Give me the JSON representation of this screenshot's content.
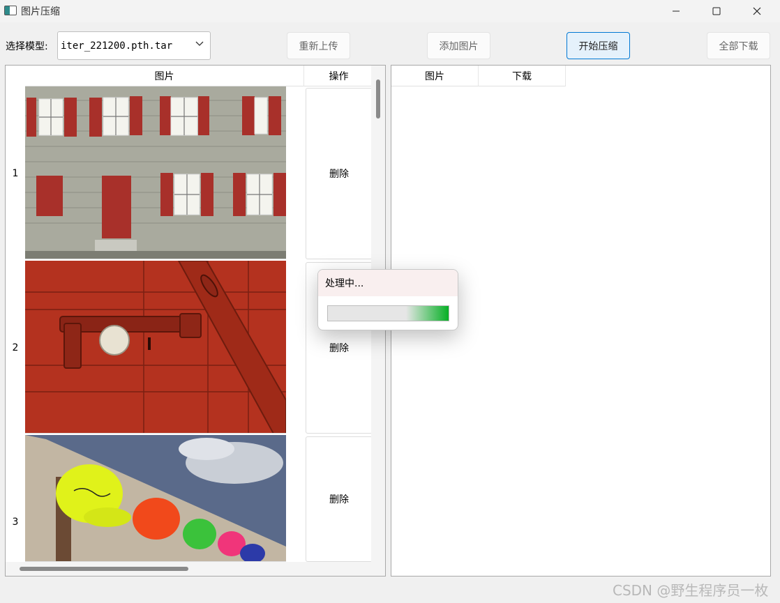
{
  "window": {
    "title": "图片压缩",
    "minimize_icon": "minimize-icon",
    "maximize_icon": "maximize-icon",
    "close_icon": "close-icon"
  },
  "toolbar": {
    "model_label": "选择模型:",
    "model_value": "iter_221200.pth.tar",
    "reupload_label": "重新上传",
    "add_image_label": "添加图片",
    "start_compress_label": "开始压缩",
    "download_all_label": "全部下载"
  },
  "left_table": {
    "columns": [
      "图片",
      "操作"
    ],
    "rows": [
      {
        "index": "1",
        "action": "删除",
        "image": "building-facade-red-shutters"
      },
      {
        "index": "2",
        "action": "删除",
        "image": "red-door-latch"
      },
      {
        "index": "3",
        "action": "删除",
        "image": "colorful-caps"
      }
    ]
  },
  "right_table": {
    "columns": [
      "图片",
      "下载"
    ]
  },
  "dialog": {
    "title": "处理中...",
    "progress": 0.35
  },
  "watermark": "CSDN @野生程序员一枚",
  "colors": {
    "accent": "#0078d4",
    "progress": "#06b025",
    "shutter_red": "#a8302a"
  }
}
